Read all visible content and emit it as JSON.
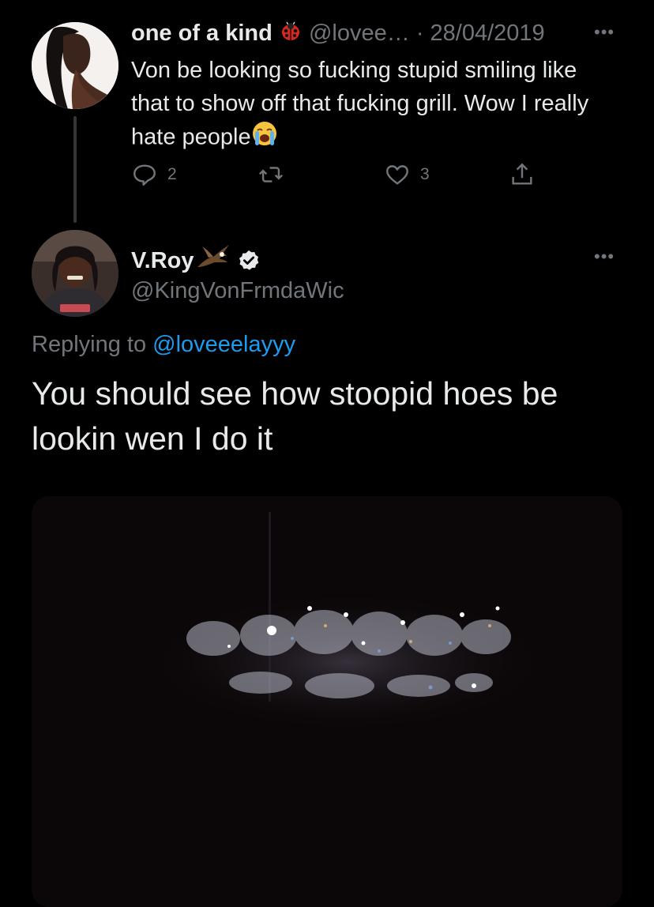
{
  "tweet1": {
    "display_name": "one of a kind",
    "name_emoji": "ladybug-emoji",
    "handle": "@lovee…",
    "separator": "·",
    "date": "28/04/2019",
    "text": "Von be looking so fucking stupid smiling like that to show off that fucking grill. Wow I really hate people",
    "text_emoji": "loudly-crying-face-emoji",
    "replies": "2",
    "retweets": "",
    "likes": "3"
  },
  "tweet2": {
    "display_name": "V.Roy",
    "name_emoji": "eagle-emoji",
    "verified": true,
    "handle": "@KingVonFrmdaWic",
    "replying_prefix": "Replying to",
    "replying_to": "@loveeelayyy",
    "text": "You should see how stoopid hoes be lookin wen I do it",
    "media": "photo-of-diamond-grill-in-dark"
  },
  "colors": {
    "background": "#000000",
    "text": "#e7e9ea",
    "muted": "#71767b",
    "link": "#1d9bf0",
    "verified_badge": "#e7e9ea"
  }
}
